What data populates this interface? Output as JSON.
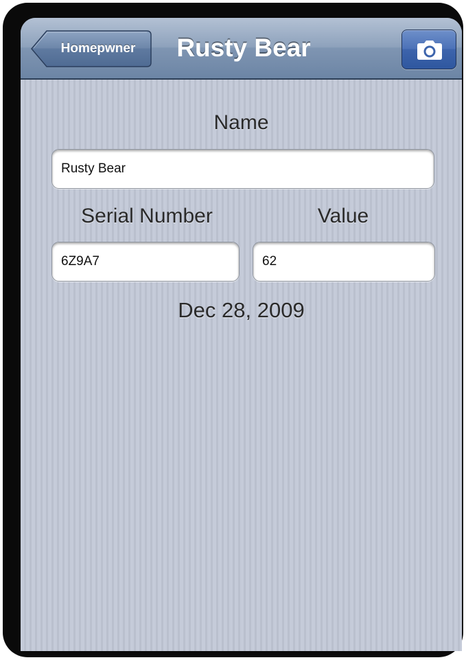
{
  "nav_bar": {
    "back_label": "Homepwner",
    "title": "Rusty Bear",
    "camera_icon": "camera-icon"
  },
  "form": {
    "name_label": "Name",
    "name_value": "Rusty Bear",
    "serial_label": "Serial Number",
    "serial_value": "6Z9A7",
    "value_label": "Value",
    "value_value": "62",
    "date": "Dec 28, 2009"
  },
  "colors": {
    "nav_bar": "#8ea2bc",
    "camera_button": "#4c72b8",
    "background_stripes": "#c5cbd9",
    "frame": "#0a0a0a"
  }
}
